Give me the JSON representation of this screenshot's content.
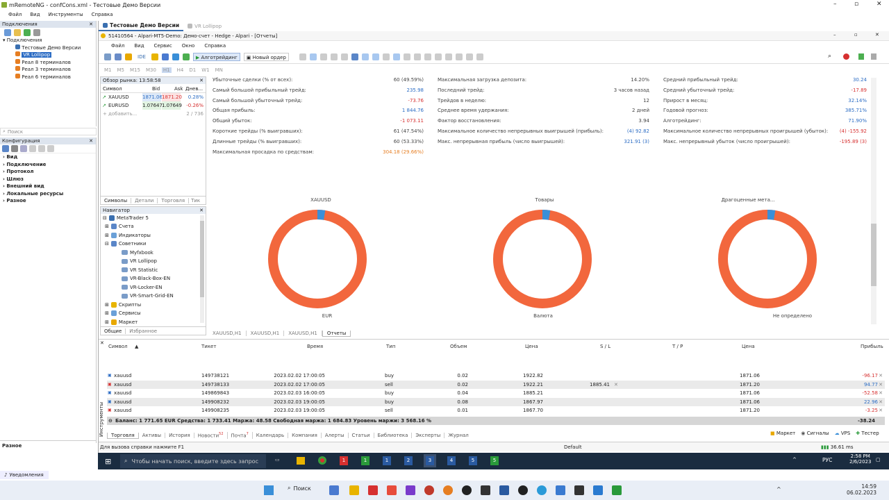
{
  "outer": {
    "title": "mRemoteNG - confCons.xml - Тестовые Демо Версии",
    "menu": [
      "Файл",
      "Вид",
      "Инструменты",
      "Справка"
    ]
  },
  "connections": {
    "header": "Подключения",
    "root": "Подключения",
    "items": [
      "Тестовые Демо Версии",
      "VR Lollipop",
      "Реал 8 терминалов",
      "Реал 3 терминалов",
      "Реал 6 терминалов"
    ]
  },
  "search": {
    "placeholder": "Поиск"
  },
  "config": {
    "header": "Конфигурация",
    "items": [
      "Вид",
      "Подключение",
      "Протокол",
      "Шлюз",
      "Внешний вид",
      "Локальные ресурсы",
      "Разное"
    ],
    "footer": "Разное"
  },
  "notifications": "Уведомления",
  "tabs": {
    "active": "Тестовые Демо Версии",
    "other": "VR Lollipop"
  },
  "mt5": {
    "title": "51410564 - Alpari-MT5-Demo: Демо-счет - Hedge - Alpari - [Отчеты]",
    "menu": [
      "Файл",
      "Вид",
      "Сервис",
      "Окно",
      "Справка"
    ],
    "ide": "IDE",
    "algo": "Алготрейдинг",
    "new_order": "Новый ордер",
    "timeframes": [
      "M1",
      "M5",
      "M15",
      "M30",
      "H1",
      "H4",
      "D1",
      "W1",
      "MN"
    ]
  },
  "market": {
    "title": "Обзор рынка: 13:58:58",
    "cols": [
      "Символ",
      "Bid",
      "Ask",
      "Днев..."
    ],
    "rows": [
      {
        "sym": "XAUUSD",
        "bid": "1871.06",
        "ask": "1871.20",
        "chg": "0.28%"
      },
      {
        "sym": "EURUSD",
        "bid": "1.07647",
        "ask": "1.07649",
        "chg": "-0.26%"
      }
    ],
    "add": "добавить...",
    "count": "2 / 736",
    "tabs": [
      "Символы",
      "Детали",
      "Торговля",
      "Тик"
    ]
  },
  "navigator": {
    "title": "Навигатор",
    "items": [
      "MetaTrader 5",
      "Счета",
      "Индикаторы",
      "Советники",
      "Myfxbook",
      "VR Lollipop",
      "VR Statistic",
      "VR-Black-Box-EN",
      "VR-Locker-EN",
      "VR-Smart-Grid-EN",
      "Скрипты",
      "Сервисы",
      "Маркет"
    ],
    "tabs": [
      "Общие",
      "Избранное"
    ]
  },
  "stats": {
    "c1": [
      [
        "Убыточные сделки (% от всех):",
        "60 (49.59%)"
      ],
      [
        "Самый большой прибыльный трейд:",
        "235.98"
      ],
      [
        "Самый большой убыточный трейд:",
        "-73.76"
      ],
      [
        "Общая прибыль:",
        "1 844.76"
      ],
      [
        "Общий убыток:",
        "-1 073.11"
      ],
      [
        "Короткие трейды (% выигравших):",
        "61 (47.54%)"
      ],
      [
        "Длинные трейды (% выигравших):",
        "60 (53.33%)"
      ],
      [
        "Максимальная просадка по средствам:",
        "304.18 (29.66%)"
      ]
    ],
    "c2": [
      [
        "Максимальная загрузка депозита:",
        "14.20%"
      ],
      [
        "Последний трейд:",
        "3 часов назад"
      ],
      [
        "Трейдов в неделю:",
        "12"
      ],
      [
        "Среднее время удержания:",
        "2 дней"
      ],
      [
        "Фактор восстановления:",
        "3.94"
      ],
      [
        "Максимальное количество непрерывных выигрышей (прибыль):",
        "(4) 92.82"
      ],
      [
        "Макс. непрерывная прибыль (число выигрышей):",
        "321.91 (3)"
      ]
    ],
    "c3": [
      [
        "Средний прибыльный трейд:",
        "30.24"
      ],
      [
        "Средний убыточный трейд:",
        "-17.89"
      ],
      [
        "Прирост в месяц:",
        "32.14%"
      ],
      [
        "Годовой прогноз:",
        "385.71%"
      ],
      [
        "Алготрейдинг:",
        "71.90%"
      ],
      [
        "Максимальное количество непрерывных проигрышей (убыток):",
        "(4) -155.92"
      ],
      [
        "Макс. непрерывный убыток (число проигрышей):",
        "-195.89 (3)"
      ]
    ]
  },
  "donuts": [
    {
      "top": "XAUUSD",
      "bottom": "EUR"
    },
    {
      "top": "Товары",
      "bottom": "Валюта"
    },
    {
      "top": "Драгоценные мета...",
      "bottom": "Не определено"
    }
  ],
  "colors": {
    "donut_main": "#f2673d",
    "donut_accent": "#3a8fd8",
    "red": "#d63030",
    "blue": "#2b6cc4"
  },
  "chart_tabs": [
    "XAUUSD,H1",
    "XAUUSD,H1",
    "XAUUSD,H1",
    "Отчеты"
  ],
  "trade": {
    "cols": [
      "Символ",
      "Тикет",
      "Время",
      "Тип",
      "Объем",
      "Цена",
      "S / L",
      "T / P",
      "Цена",
      "Прибыль"
    ],
    "rows": [
      {
        "sym": "xauusd",
        "ticket": "149738121",
        "time": "2023.02.02 17:00:05",
        "type": "buy",
        "vol": "0.02",
        "price": "1922.82",
        "sl": "",
        "cur": "1871.06",
        "profit": "-96.17"
      },
      {
        "sym": "xauusd",
        "ticket": "149738133",
        "time": "2023.02.02 17:00:05",
        "type": "sell",
        "vol": "0.02",
        "price": "1922.21",
        "sl": "1885.41",
        "cur": "1871.20",
        "profit": "94.77"
      },
      {
        "sym": "xauusd",
        "ticket": "149869843",
        "time": "2023.02.03 16:00:05",
        "type": "buy",
        "vol": "0.04",
        "price": "1885.21",
        "sl": "",
        "cur": "1871.06",
        "profit": "-52.58"
      },
      {
        "sym": "xauusd",
        "ticket": "149908232",
        "time": "2023.02.03 19:00:05",
        "type": "buy",
        "vol": "0.08",
        "price": "1867.97",
        "sl": "",
        "cur": "1871.06",
        "profit": "22.96"
      },
      {
        "sym": "xauusd",
        "ticket": "149908235",
        "time": "2023.02.03 19:00:05",
        "type": "sell",
        "vol": "0.01",
        "price": "1867.70",
        "sl": "",
        "cur": "1871.20",
        "profit": "-3.25"
      }
    ],
    "balance": "Баланс: 1 771.65 EUR  Средства: 1 733.41  Маржа: 48.58  Свободная маржа: 1 684.83  Уровень маржи: 3 568.16 %",
    "total": "-38.24",
    "side": "Инструменты"
  },
  "bottom_tabs": [
    "Торговля",
    "Активы",
    "История",
    "Новости",
    "Почта",
    "Календарь",
    "Компания",
    "Алерты",
    "Статьи",
    "Библиотека",
    "Эксперты",
    "Журнал"
  ],
  "news_badge": "52",
  "mail_badge": "7",
  "right_tabs": [
    "Маркет",
    "Сигналы",
    "VPS",
    "Тестер"
  ],
  "status": {
    "help": "Для вызова справки нажмите F1",
    "profile": "Default",
    "speed": "36.61 ms"
  },
  "remote_taskbar": {
    "search": "Чтобы начать поиск, введите здесь запрос",
    "lang": "РУС",
    "time": "2:58 PM",
    "date": "2/6/2023",
    "apps": [
      "1",
      "1",
      "1",
      "2",
      "3",
      "4",
      "5",
      "5"
    ]
  },
  "win11": {
    "search": "Поиск",
    "time": "14:59",
    "date": "06.02.2023"
  }
}
